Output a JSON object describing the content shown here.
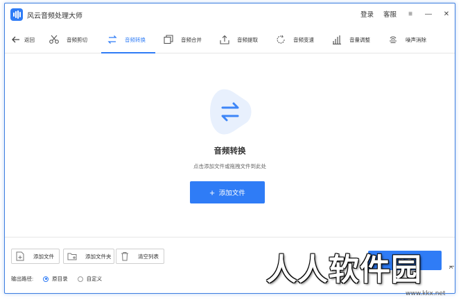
{
  "app": {
    "title": "风云音频处理大师",
    "login": "登录",
    "service": "客服",
    "menu_glyph": "≡",
    "minimize_glyph": "—",
    "close_glyph": "✕"
  },
  "toolbar": {
    "back_label": "返回",
    "tabs": [
      {
        "label": "音频剪切",
        "icon": "scissors-icon",
        "active": false
      },
      {
        "label": "音频转换",
        "icon": "convert-icon",
        "active": true
      },
      {
        "label": "音频合并",
        "icon": "merge-icon",
        "active": false
      },
      {
        "label": "音频提取",
        "icon": "upload-icon",
        "active": false
      },
      {
        "label": "音频变速",
        "icon": "speed-icon",
        "active": false
      },
      {
        "label": "音量调整",
        "icon": "volume-bars-icon",
        "active": false
      },
      {
        "label": "噪声消除",
        "icon": "noise-icon",
        "active": false
      }
    ]
  },
  "main": {
    "title": "音频转换",
    "hint": "点击添加文件或拖拽文件到此处",
    "add_button": "添加文件",
    "add_plus": "+"
  },
  "bottom": {
    "add_file": "添加文件",
    "add_folder": "添加文件夹",
    "clear_list": "清空列表",
    "process_button": "处理",
    "output_label": "输出路径:",
    "options": [
      {
        "label": "原目录",
        "checked": true
      },
      {
        "label": "自定义",
        "checked": false
      }
    ]
  },
  "watermark": {
    "text": "人人软件园",
    "url": "www.kkx.net",
    "side": "k"
  },
  "colors": {
    "accent": "#2f7cf6",
    "border": "#3c7de0",
    "hero_bg": "#e8f0fd"
  }
}
